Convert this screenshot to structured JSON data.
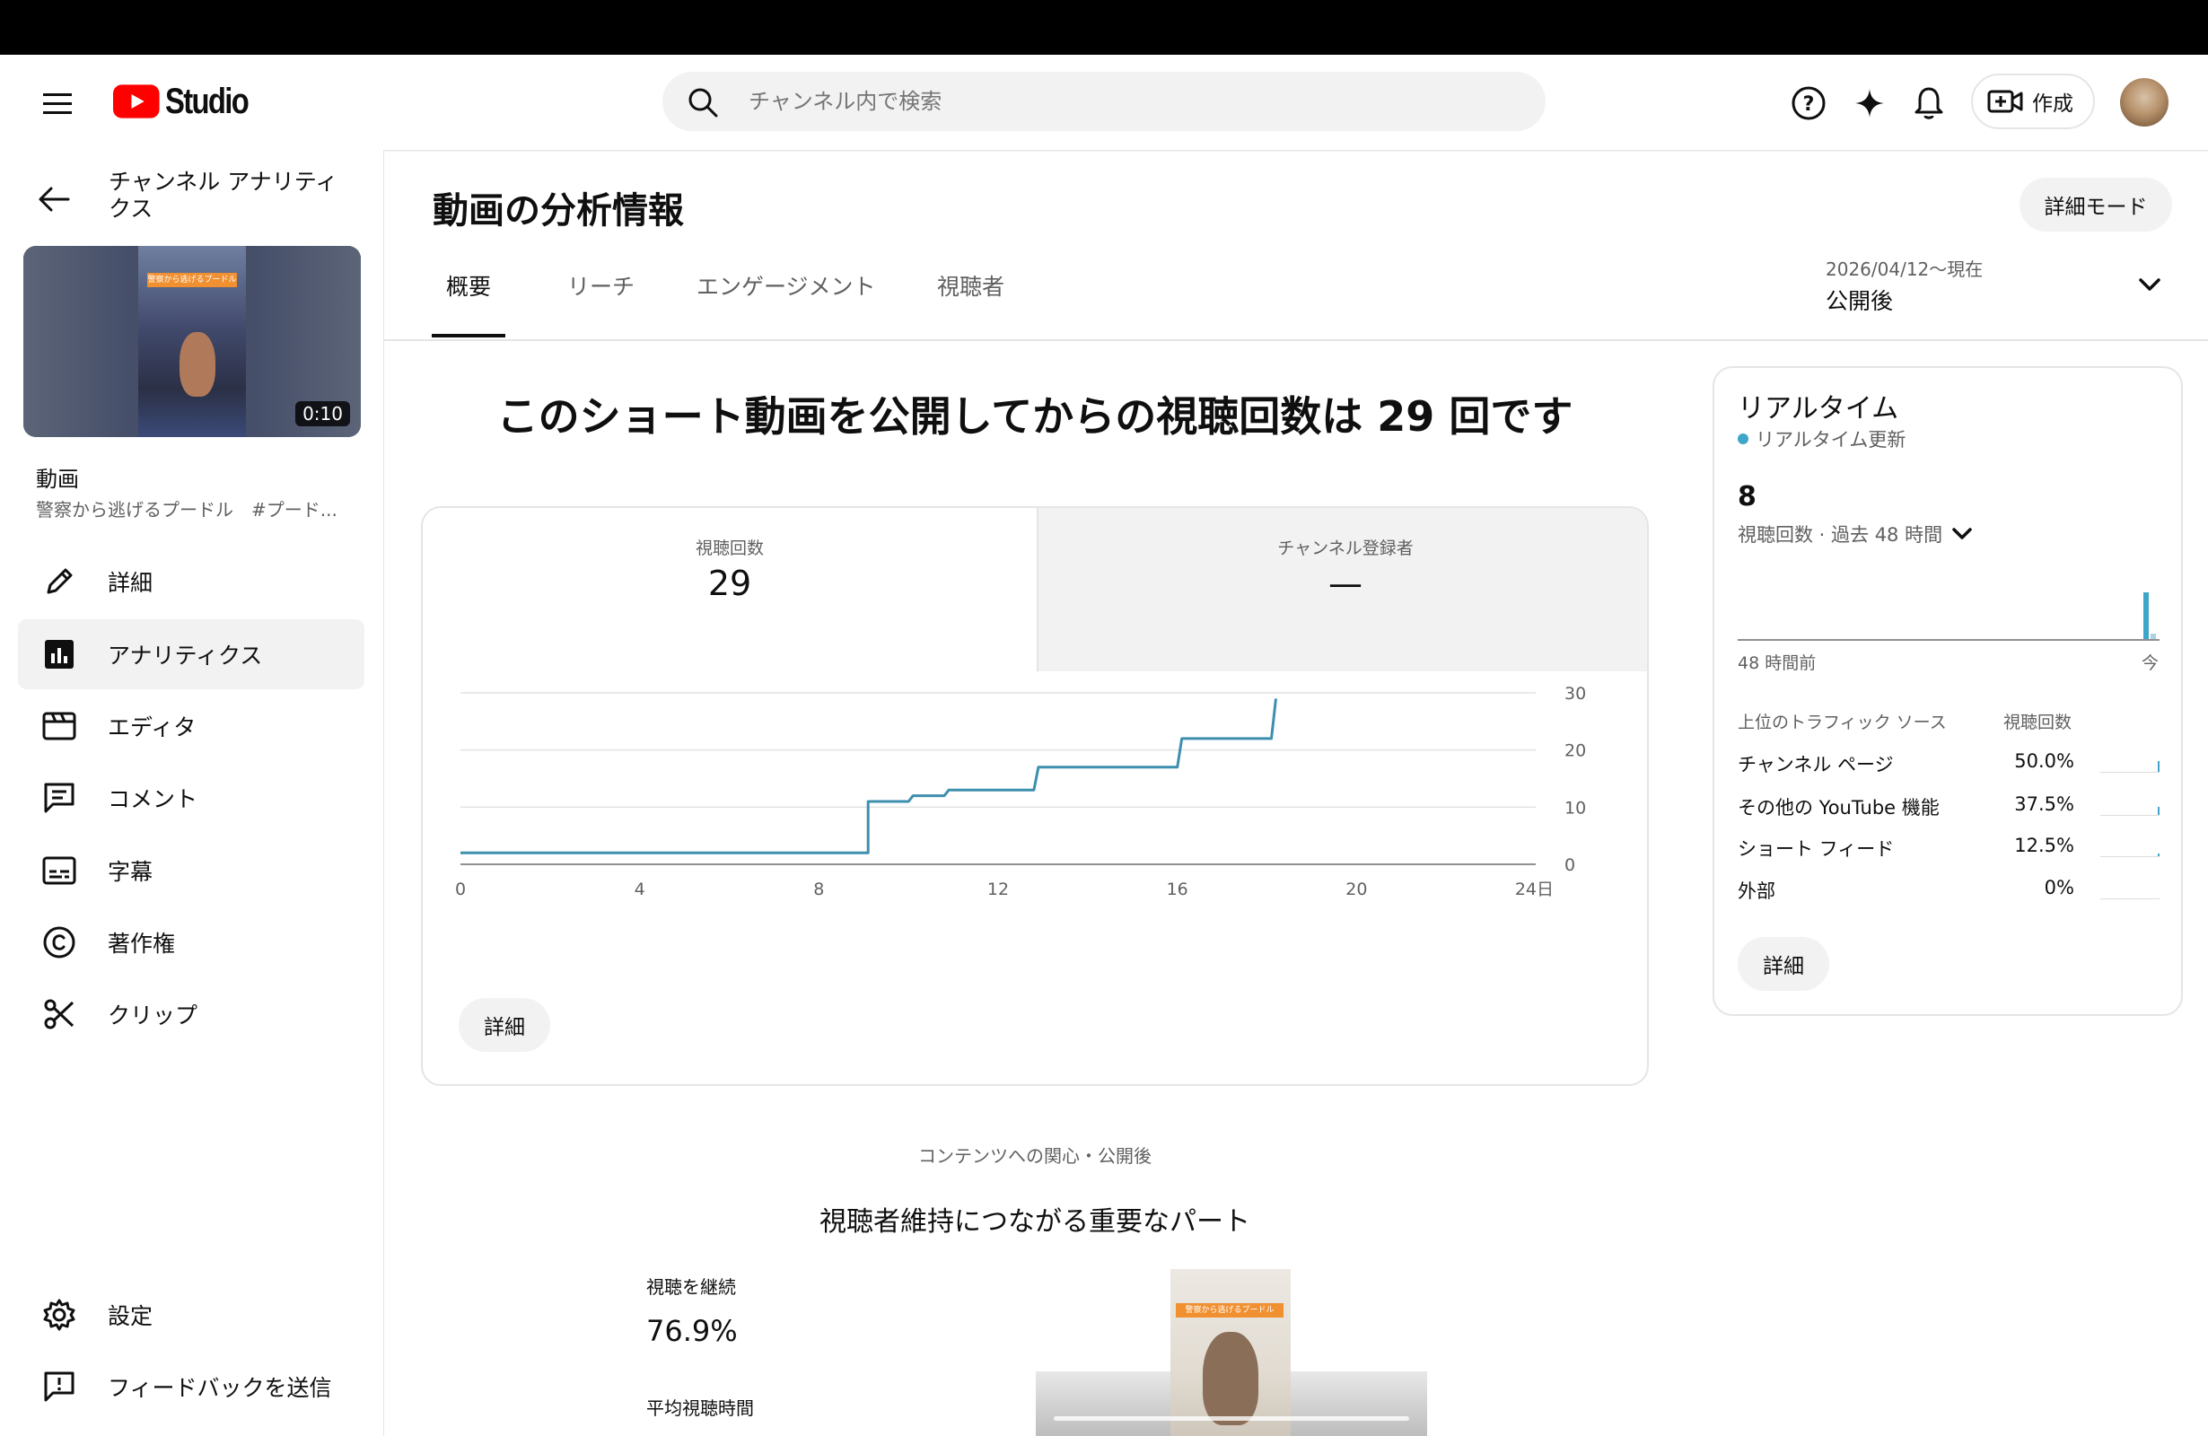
{
  "app": {
    "brand_studio": "Studio"
  },
  "header": {
    "search_placeholder": "チャンネル内で検索",
    "create_label": "作成"
  },
  "sidebar": {
    "back_title": "チャンネル アナリティクス",
    "thumb_caption": "警察から逃げるプードル",
    "duration": "0:10",
    "video_label": "動画",
    "video_title": "警察から逃げるプードル　#プード...",
    "items": [
      {
        "label": "詳細",
        "icon": "pencil-icon"
      },
      {
        "label": "アナリティクス",
        "icon": "analytics-icon",
        "active": true
      },
      {
        "label": "エディタ",
        "icon": "editor-icon"
      },
      {
        "label": "コメント",
        "icon": "comment-icon"
      },
      {
        "label": "字幕",
        "icon": "subtitles-icon"
      },
      {
        "label": "著作権",
        "icon": "copyright-icon"
      },
      {
        "label": "クリップ",
        "icon": "scissors-icon"
      }
    ],
    "bottom_items": [
      {
        "label": "設定",
        "icon": "gear-icon"
      },
      {
        "label": "フィードバックを送信",
        "icon": "feedback-icon"
      }
    ]
  },
  "main": {
    "page_title": "動画の分析情報",
    "advanced_mode_label": "詳細モード",
    "tabs": [
      "概要",
      "リーチ",
      "エンゲージメント",
      "視聴者"
    ],
    "active_tab": 0,
    "date_range": {
      "range": "2026/04/12〜現在",
      "label": "公開後"
    },
    "headline": "このショート動画を公開してからの視聴回数は 29 回です",
    "metrics": [
      {
        "label": "視聴回数",
        "value": "29"
      },
      {
        "label": "チャンネル登録者",
        "value": "—"
      }
    ],
    "chart_more_label": "詳細",
    "section_subtitle": "コンテンツへの関心・公開後",
    "section_title": "視聴者維持につながる重要なパート",
    "retention": {
      "label": "視聴を継続",
      "value": "76.9%",
      "avg_label": "平均視聴時間"
    }
  },
  "realtime": {
    "title": "リアルタイム",
    "status": "リアルタイム更新",
    "count": "8",
    "count_label": "視聴回数 · 過去 48 時間",
    "axis_start": "48 時間前",
    "axis_end": "今",
    "traffic_header": "上位のトラフィック ソース",
    "traffic_col": "視聴回数",
    "sources": [
      {
        "name": "チャンネル ページ",
        "pct": "50.0%",
        "share": 0.5
      },
      {
        "name": "その他の YouTube 機能",
        "pct": "37.5%",
        "share": 0.375
      },
      {
        "name": "ショート フィード",
        "pct": "12.5%",
        "share": 0.125
      },
      {
        "name": "外部",
        "pct": "0%",
        "share": 0
      }
    ],
    "more_label": "詳細"
  },
  "chart_data": {
    "type": "line",
    "series": [
      {
        "values_xy": [
          [
            0,
            2
          ],
          [
            9.1,
            2
          ],
          [
            9.1,
            11
          ],
          [
            10.0,
            11
          ],
          [
            10.1,
            12
          ],
          [
            10.8,
            12
          ],
          [
            10.9,
            13
          ],
          [
            12.8,
            13
          ],
          [
            12.9,
            17
          ],
          [
            16.0,
            17
          ],
          [
            16.1,
            22
          ],
          [
            18.1,
            22
          ],
          [
            18.2,
            29
          ]
        ]
      }
    ],
    "x_ticks": [
      "0",
      "4",
      "8",
      "12",
      "16",
      "20",
      "24日"
    ],
    "y_ticks": [
      "0",
      "10",
      "20",
      "30"
    ],
    "xlim": [
      0,
      24
    ],
    "ylim": [
      0,
      30
    ],
    "color": "#3e8fae",
    "grid": true
  },
  "colors": {
    "accent": "#3ea6c8",
    "brand_red": "#ff0000"
  }
}
